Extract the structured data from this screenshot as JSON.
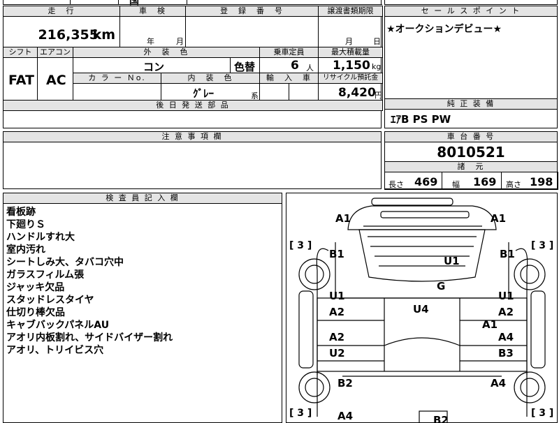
{
  "top_strip": {
    "partial_text": "国"
  },
  "grid": {
    "mileage": {
      "header": "走　行",
      "value": "216,355",
      "unit": "km"
    },
    "inspection": {
      "header": "車　検",
      "year_label": "年",
      "month_label": "月"
    },
    "registration": {
      "header": "登　録　番　号",
      "value": ""
    },
    "transfer": {
      "header": "譲渡書類期限",
      "month_label": "月",
      "day_label": "日"
    },
    "shift": {
      "header": "シフト",
      "value": "FAT"
    },
    "aircon": {
      "header": "エアコン",
      "value": "AC"
    },
    "exterior_color": {
      "header": "外　装　色",
      "value": "コン",
      "change_label": "色替"
    },
    "capacity": {
      "header": "乗車定員",
      "value": "6",
      "unit": "人"
    },
    "max_load": {
      "header": "最大積載量",
      "value": "1,150",
      "unit": "kg"
    },
    "color_no": {
      "header": "カ ラ ー Ｎo.",
      "value": ""
    },
    "interior_color": {
      "header": "内　装　色",
      "value": "ｸﾞﾚｰ",
      "unit": "系"
    },
    "import": {
      "header": "輸　入　車",
      "value": ""
    },
    "recycle": {
      "header": "リサイクル預託金",
      "value": "8,420",
      "unit": "円"
    },
    "later_parts": {
      "header": "後 日 発 送 部 品",
      "value": ""
    }
  },
  "sales_point": {
    "header": "セ ー ル ス ポ イ ン ト",
    "text": "★オークションデビュー★"
  },
  "factory_equipment": {
    "header": "純 正 装 備",
    "text": "ｴｱB PS PW"
  },
  "notes": {
    "header": "注 意 事 項 欄",
    "text": ""
  },
  "chassis": {
    "header": "車 台 番 号",
    "value": "8010521",
    "spec_header": "諸　元",
    "length_label": "長さ",
    "length": "469",
    "width_label": "幅",
    "width": "169",
    "height_label": "高さ",
    "height": "198"
  },
  "inspector": {
    "header": "検 査 員 記 入 欄",
    "lines": [
      "看板跡",
      "下廻りＳ",
      "ハンドルすれ大",
      "室内汚れ",
      "シートしみ大、タバコ穴中",
      "ガラスフィルム張",
      "ジャッキ欠品",
      "スタッドレスタイヤ",
      "仕切り棒欠品",
      "キャブバックパネルAU",
      "アオリ内板割れ、サイドバイザー割れ",
      "アオリ、トリイビス穴"
    ]
  },
  "diagram": {
    "tread_left_top": "[ 3 ]",
    "tread_right_top": "[ 3 ]",
    "tread_left_bottom": "[ 3 ]",
    "tread_right_bottom": "[ 3 ]",
    "labels": [
      "A1",
      "A1",
      "B1",
      "B1",
      "U1",
      "G",
      "U1",
      "U1",
      "A2",
      "A2",
      "U4",
      "A1",
      "A2",
      "A4",
      "U2",
      "B3",
      "B2",
      "A4",
      "A4",
      "B2"
    ]
  }
}
